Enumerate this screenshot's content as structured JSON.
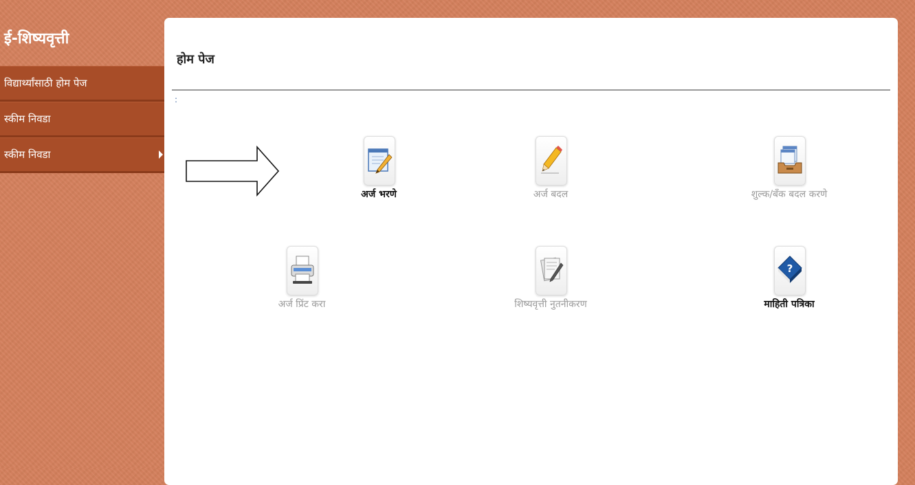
{
  "sidebar": {
    "app_title": "ई-शिष्यवृत्ती",
    "items": [
      {
        "label": "विद्यार्थ्यांसाठी होम पेज"
      },
      {
        "label": "स्कीम निवडा"
      },
      {
        "label": "स्कीम निवडा"
      }
    ]
  },
  "main": {
    "page_title": "होम पेज",
    "colon_mark": ":",
    "tiles": [
      {
        "label": "अर्ज भरणे",
        "icon": "pencil-notepad-icon",
        "state": "active"
      },
      {
        "label": "अर्ज बदल",
        "icon": "pencil-icon",
        "state": "disabled"
      },
      {
        "label": "शुल्क/बँक बदल करणे",
        "icon": "document-tray-icon",
        "state": "disabled"
      },
      {
        "label": "अर्ज प्रिंट करा",
        "icon": "printer-icon",
        "state": "disabled"
      },
      {
        "label": "शिष्यवृत्ती नुतनीकरण",
        "icon": "documents-pen-icon",
        "state": "disabled"
      },
      {
        "label": "माहिती पत्रिका",
        "icon": "help-book-icon",
        "state": "active"
      }
    ]
  },
  "colors": {
    "background": "#d4805c",
    "menu_item": "#a84d28",
    "active_text": "#111111",
    "disabled_text": "#9a9a9a"
  }
}
